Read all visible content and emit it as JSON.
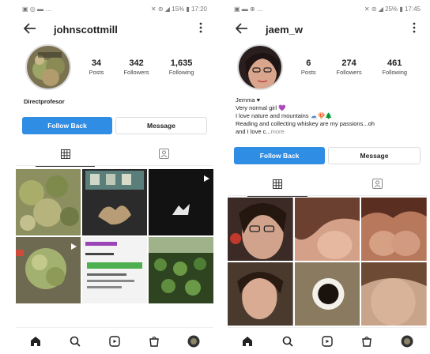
{
  "left": {
    "status": {
      "left": "▣ ◎ ▬ …",
      "right": "✕ ⊜ ◢ 15% ▮ 17:20"
    },
    "username": "johnscottmill",
    "stats": [
      {
        "value": "34",
        "label": "Posts"
      },
      {
        "value": "342",
        "label": "Followers"
      },
      {
        "value": "1,635",
        "label": "Following"
      }
    ],
    "bio_name": "Directprofesor",
    "follow_label": "Follow Back",
    "message_label": "Message"
  },
  "right": {
    "status": {
      "left": "▣ ▬ ⊕ …",
      "right": "✕ ⊜ ◢ 25% ▮ 17:45"
    },
    "username": "jaem_w",
    "stats": [
      {
        "value": "6",
        "label": "Posts"
      },
      {
        "value": "274",
        "label": "Followers"
      },
      {
        "value": "461",
        "label": "Following"
      }
    ],
    "bio": {
      "name": "Jemma ♥",
      "line1": "Very normal girl 💜",
      "line2": "I love nature and mountains 🗻🍄🌲",
      "line3": "Reading and collecting whiskey are my passions...oh",
      "line4": "and I love c...",
      "more": "more"
    },
    "follow_label": "Follow Back",
    "message_label": "Message"
  },
  "icons": [
    "back-arrow-icon",
    "more-options-icon",
    "grid-icon",
    "tagged-icon",
    "home-icon",
    "search-icon",
    "reels-icon",
    "shop-icon",
    "profile-avatar-icon",
    "play-icon"
  ],
  "colors": {
    "follow_button": "#2f8de4",
    "text": "#222222"
  }
}
